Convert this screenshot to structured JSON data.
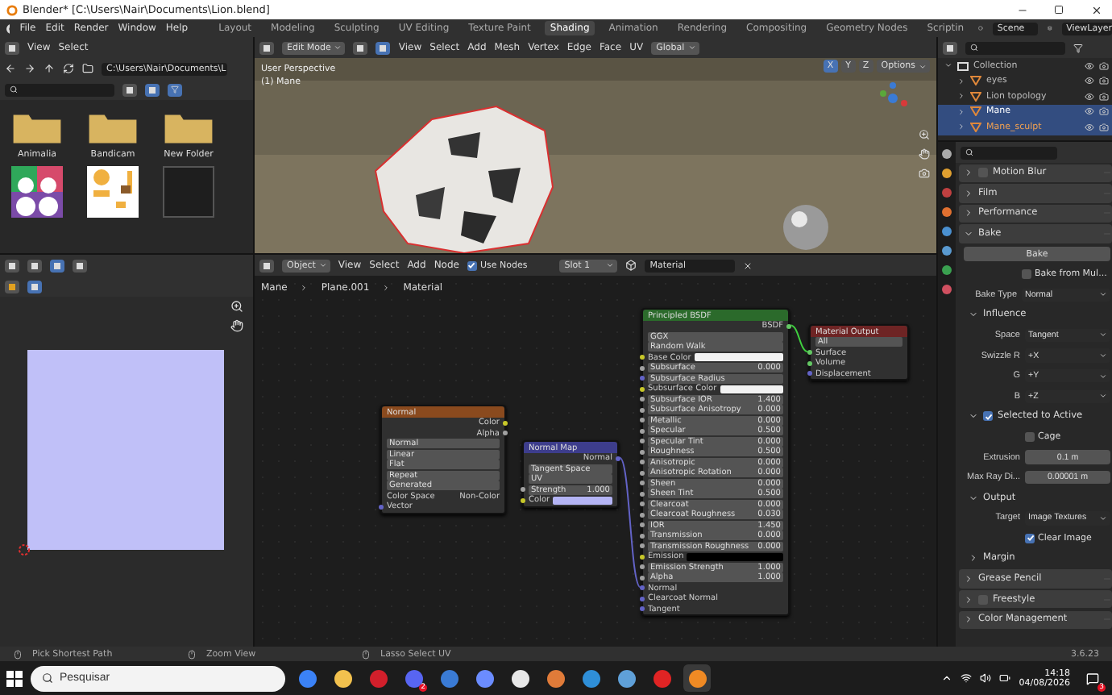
{
  "window": {
    "title": "Blender* [C:\\Users\\Nair\\Documents\\Lion.blend]"
  },
  "menu": [
    "File",
    "Edit",
    "Render",
    "Window",
    "Help"
  ],
  "workspaces": [
    {
      "label": "Layout",
      "selected": false
    },
    {
      "label": "Modeling",
      "selected": false
    },
    {
      "label": "Sculpting",
      "selected": false
    },
    {
      "label": "UV Editing",
      "selected": false
    },
    {
      "label": "Texture Paint",
      "selected": false
    },
    {
      "label": "Shading",
      "selected": true
    },
    {
      "label": "Animation",
      "selected": false
    },
    {
      "label": "Rendering",
      "selected": false
    },
    {
      "label": "Compositing",
      "selected": false
    },
    {
      "label": "Geometry Nodes",
      "selected": false
    },
    {
      "label": "Scriptin",
      "selected": false
    }
  ],
  "scene": "Scene",
  "view_layer": "ViewLayer",
  "file_browser": {
    "menu": [
      "View",
      "Select"
    ],
    "path": "C:\\Users\\Nair\\Documents\\L",
    "items": [
      {
        "kind": "folder",
        "name": "Animalia"
      },
      {
        "kind": "folder",
        "name": "Bandicam"
      },
      {
        "kind": "folder",
        "name": "New Folder"
      },
      {
        "kind": "colorful"
      },
      {
        "kind": "sheet"
      },
      {
        "kind": "blank"
      }
    ]
  },
  "viewport": {
    "mode": "Edit Mode",
    "menu": [
      "View",
      "Select",
      "Add",
      "Mesh",
      "Vertex",
      "Edge",
      "Face",
      "UV"
    ],
    "orientation": "Global",
    "options": "Options",
    "overlay": [
      "User Perspective",
      "(1) Mane"
    ],
    "axes": [
      {
        "label": "X",
        "selected": true
      },
      {
        "label": "Y",
        "selected": false
      },
      {
        "label": "Z",
        "selected": false
      }
    ]
  },
  "node_editor": {
    "type": "Object",
    "menu": [
      "View",
      "Select",
      "Add",
      "Node"
    ],
    "use_nodes": true,
    "use_nodes_label": "Use Nodes",
    "slot": "Slot 1",
    "material": "Material",
    "breadcrumbs": [
      "Mane",
      "Plane.001",
      "Material"
    ],
    "nodes": [
      {
        "title": "Normal",
        "color": "#8a4a1e",
        "rows": [
          {
            "kind": "out",
            "label": "Color",
            "socket": {
              "color": "#c7c729"
            }
          },
          {
            "kind": "out",
            "label": "Alpha",
            "socket": {
              "color": "#a1a1a1"
            }
          },
          {
            "kind": "field",
            "value": "Normal"
          },
          {
            "kind": "menu",
            "value": "Linear"
          },
          {
            "kind": "menu",
            "value": "Flat"
          },
          {
            "kind": "menu",
            "value": "Repeat"
          },
          {
            "kind": "menu",
            "value": "Generated"
          },
          {
            "kind": "pair",
            "label": "Color Space",
            "value": "Non-Color"
          },
          {
            "kind": "in",
            "label": "Vector",
            "socket": {
              "color": "#6363c7"
            }
          }
        ]
      },
      {
        "title": "Normal Map",
        "color": "#3d3d8c",
        "rows": [
          {
            "kind": "out",
            "label": "Normal",
            "socket": {
              "color": "#6363c7"
            }
          },
          {
            "kind": "menu",
            "value": "Tangent Space"
          },
          {
            "kind": "field",
            "value": "UV"
          },
          {
            "kind": "num",
            "label": "Strength",
            "value": "1.000",
            "socket": {
              "color": "#a1a1a1"
            }
          },
          {
            "kind": "swatch",
            "label": "Color",
            "color": "#b4b4f4",
            "socket": {
              "color": "#c7c729"
            }
          }
        ]
      },
      {
        "title": "Principled BSDF",
        "color": "#2b6a2b",
        "rows": [
          {
            "kind": "out",
            "label": "BSDF",
            "socket": {
              "color": "#63c763"
            }
          },
          {
            "kind": "menu",
            "value": "GGX"
          },
          {
            "kind": "menu",
            "value": "Random Walk"
          },
          {
            "kind": "swatch",
            "label": "Base Color",
            "color": "#f2f2f2",
            "socket": {
              "color": "#c7c729"
            }
          },
          {
            "kind": "num",
            "label": "Subsurface",
            "value": "0.000",
            "socket": {
              "color": "#a1a1a1"
            }
          },
          {
            "kind": "menu",
            "value": "Subsurface Radius",
            "socket": {
              "color": "#6363c7"
            }
          },
          {
            "kind": "swatch",
            "label": "Subsurface Color",
            "color": "#f2f2f2",
            "socket": {
              "color": "#c7c729"
            }
          },
          {
            "kind": "num",
            "label": "Subsurface IOR",
            "value": "1.400",
            "socket": {
              "color": "#a1a1a1"
            }
          },
          {
            "kind": "num",
            "label": "Subsurface Anisotropy",
            "value": "0.000",
            "socket": {
              "color": "#a1a1a1"
            }
          },
          {
            "kind": "num",
            "label": "Metallic",
            "value": "0.000",
            "socket": {
              "color": "#a1a1a1"
            }
          },
          {
            "kind": "num",
            "label": "Specular",
            "value": "0.500",
            "socket": {
              "color": "#a1a1a1"
            }
          },
          {
            "kind": "num",
            "label": "Specular Tint",
            "value": "0.000",
            "socket": {
              "color": "#a1a1a1"
            }
          },
          {
            "kind": "num",
            "label": "Roughness",
            "value": "0.500",
            "socket": {
              "color": "#a1a1a1"
            }
          },
          {
            "kind": "num",
            "label": "Anisotropic",
            "value": "0.000",
            "socket": {
              "color": "#a1a1a1"
            }
          },
          {
            "kind": "num",
            "label": "Anisotropic Rotation",
            "value": "0.000",
            "socket": {
              "color": "#a1a1a1"
            }
          },
          {
            "kind": "num",
            "label": "Sheen",
            "value": "0.000",
            "socket": {
              "color": "#a1a1a1"
            }
          },
          {
            "kind": "num",
            "label": "Sheen Tint",
            "value": "0.500",
            "socket": {
              "color": "#a1a1a1"
            }
          },
          {
            "kind": "num",
            "label": "Clearcoat",
            "value": "0.000",
            "socket": {
              "color": "#a1a1a1"
            }
          },
          {
            "kind": "num",
            "label": "Clearcoat Roughness",
            "value": "0.030",
            "socket": {
              "color": "#a1a1a1"
            }
          },
          {
            "kind": "num",
            "label": "IOR",
            "value": "1.450",
            "socket": {
              "color": "#a1a1a1"
            }
          },
          {
            "kind": "num",
            "label": "Transmission",
            "value": "0.000",
            "socket": {
              "color": "#a1a1a1"
            }
          },
          {
            "kind": "num",
            "label": "Transmission Roughness",
            "value": "0.000",
            "socket": {
              "color": "#a1a1a1"
            }
          },
          {
            "kind": "swatch",
            "label": "Emission",
            "color": "#000000",
            "socket": {
              "color": "#c7c729"
            }
          },
          {
            "kind": "num",
            "label": "Emission Strength",
            "value": "1.000",
            "socket": {
              "color": "#a1a1a1"
            }
          },
          {
            "kind": "num",
            "label": "Alpha",
            "value": "1.000",
            "socket": {
              "color": "#a1a1a1"
            }
          },
          {
            "kind": "in",
            "label": "Normal",
            "socket": {
              "color": "#6363c7"
            }
          },
          {
            "kind": "in",
            "label": "Clearcoat Normal",
            "socket": {
              "color": "#6363c7"
            }
          },
          {
            "kind": "in",
            "label": "Tangent",
            "socket": {
              "color": "#6363c7"
            }
          }
        ]
      },
      {
        "title": "Material Output",
        "color": "#6e2424",
        "rows": [
          {
            "kind": "menu",
            "value": "All"
          },
          {
            "kind": "in",
            "label": "Surface",
            "socket": {
              "color": "#63c763"
            }
          },
          {
            "kind": "in",
            "label": "Volume",
            "socket": {
              "color": "#63c763"
            }
          },
          {
            "kind": "in",
            "label": "Displacement",
            "socket": {
              "color": "#6363c7"
            }
          }
        ]
      }
    ],
    "links": [
      {
        "color": "#6363c7"
      },
      {
        "color": "#3fd13f"
      }
    ]
  },
  "outliner": [
    {
      "name": "Collection",
      "kind": "collection",
      "expanded": true,
      "selected": false,
      "active": false,
      "children": [
        {
          "name": "eyes",
          "kind": "mesh",
          "expanded": false,
          "selected": false,
          "active": false
        },
        {
          "name": "Lion topology",
          "kind": "mesh",
          "expanded": false,
          "selected": false,
          "active": false
        },
        {
          "name": "Mane",
          "kind": "mesh",
          "expanded": false,
          "selected": true,
          "active": true
        },
        {
          "name": "Mane_sculpt",
          "kind": "mesh",
          "expanded": false,
          "selected": true,
          "active": false
        }
      ]
    }
  ],
  "properties": [
    {
      "kind": "panel",
      "label": "Motion Blur",
      "expanded": false,
      "checked": false
    },
    {
      "kind": "panel",
      "label": "Film",
      "expanded": false
    },
    {
      "kind": "panel",
      "label": "Performance",
      "expanded": false
    },
    {
      "kind": "panel",
      "label": "Bake",
      "expanded": true,
      "children": [
        {
          "kind": "button",
          "label": "Bake"
        },
        {
          "kind": "check",
          "label": "Bake from Mul...",
          "checked": false
        },
        {
          "kind": "select",
          "label": "Bake Type",
          "value": "Normal"
        },
        {
          "kind": "panel",
          "label": "Influence",
          "expanded": true,
          "children": [
            {
              "kind": "select",
              "label": "Space",
              "value": "Tangent"
            },
            {
              "kind": "select",
              "label": "Swizzle R",
              "value": "+X"
            },
            {
              "kind": "select",
              "label": "G",
              "value": "+Y"
            },
            {
              "kind": "select",
              "label": "B",
              "value": "+Z"
            }
          ]
        },
        {
          "kind": "panel",
          "label": "Selected to Active",
          "expanded": true,
          "checked": true,
          "children": [
            {
              "kind": "check",
              "label": "Cage",
              "checked": false
            },
            {
              "kind": "number",
              "label": "Extrusion",
              "value": "0.1 m"
            },
            {
              "kind": "number",
              "label": "Max Ray Di...",
              "value": "0.00001 m"
            }
          ]
        },
        {
          "kind": "panel",
          "label": "Output",
          "expanded": true,
          "children": [
            {
              "kind": "select",
              "label": "Target",
              "value": "Image Textures"
            },
            {
              "kind": "check",
              "label": "Clear Image",
              "checked": true
            }
          ]
        },
        {
          "kind": "panel",
          "label": "Margin",
          "expanded": false
        }
      ]
    },
    {
      "kind": "panel",
      "label": "Grease Pencil",
      "expanded": false
    },
    {
      "kind": "panel",
      "label": "Freestyle",
      "expanded": false,
      "checked": false
    },
    {
      "kind": "panel",
      "label": "Color Management",
      "expanded": false
    }
  ],
  "status_bar": {
    "hints": [
      "Pick Shortest Path",
      "Zoom View",
      "Lasso Select UV"
    ],
    "version": "3.6.23"
  },
  "taskbar": {
    "search": {
      "placeholder": "Pesquisar"
    },
    "apps": [
      {
        "color": "#3b82f6",
        "selected": false
      },
      {
        "color": "#f2c14e",
        "selected": false
      },
      {
        "color": "#d21f2b",
        "selected": false
      },
      {
        "color": "#5865f2",
        "selected": false,
        "badge": "2"
      },
      {
        "color": "#3a7bd5",
        "selected": false
      },
      {
        "color": "#6b8cff",
        "selected": false
      },
      {
        "color": "#e8e8e8",
        "selected": false
      },
      {
        "color": "#e07b39",
        "selected": false
      },
      {
        "color": "#2f8fd8",
        "selected": false
      },
      {
        "color": "#5fa0d8",
        "selected": false
      },
      {
        "color": "#e02424",
        "selected": false
      },
      {
        "color": "#f08a24",
        "selected": true
      }
    ],
    "time": "14:18",
    "date": "04/08/2026",
    "notifications": "3"
  }
}
